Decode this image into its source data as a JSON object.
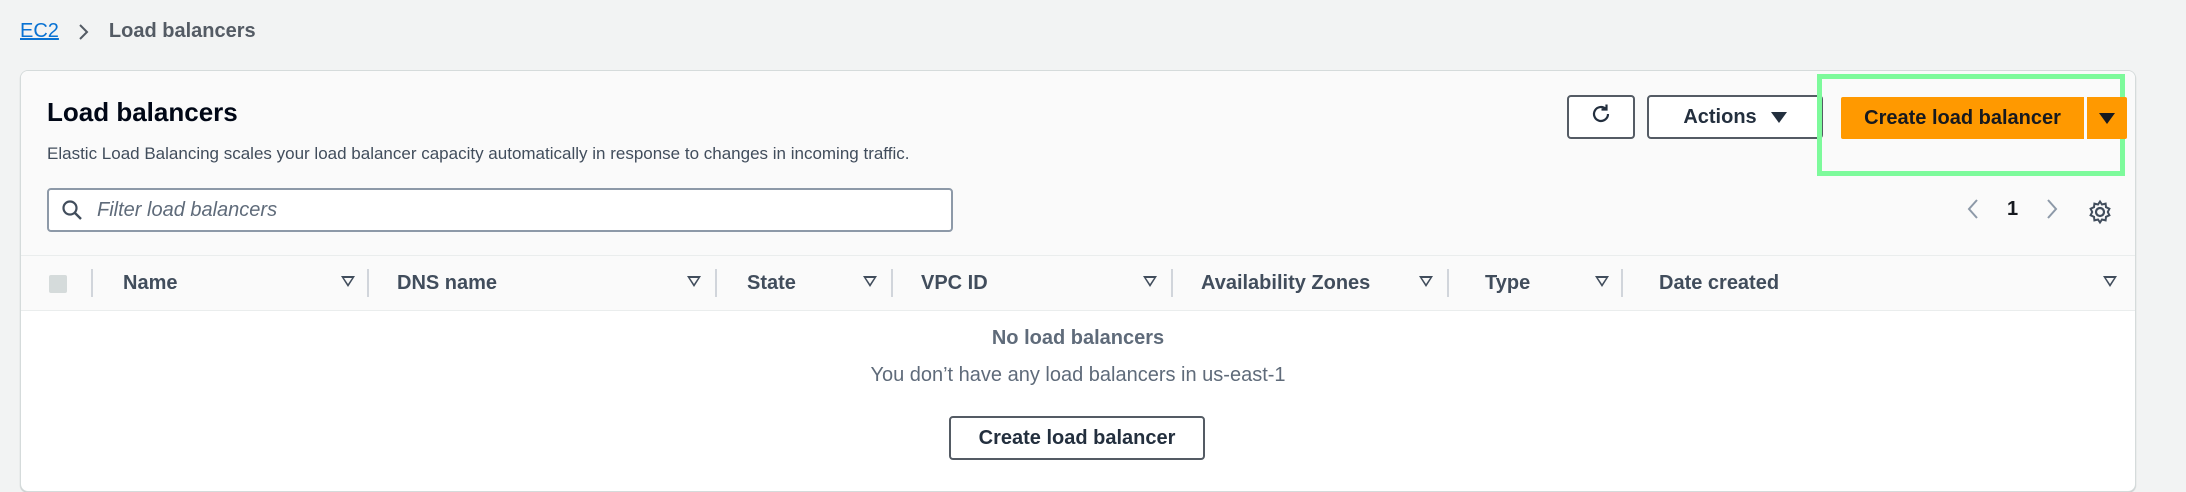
{
  "breadcrumb": {
    "root": "EC2",
    "current": "Load balancers"
  },
  "panel": {
    "title": "Load balancers",
    "description": "Elastic Load Balancing scales your load balancer capacity automatically in response to changes in incoming traffic."
  },
  "toolbar": {
    "actions_label": "Actions",
    "create_label": "Create load balancer"
  },
  "search": {
    "placeholder": "Filter load balancers",
    "value": ""
  },
  "pagination": {
    "current_page": "1"
  },
  "table": {
    "columns": [
      "Name",
      "DNS name",
      "State",
      "VPC ID",
      "Availability Zones",
      "Type",
      "Date created"
    ]
  },
  "empty_state": {
    "title": "No load balancers",
    "message": "You don’t have any load balancers in us-east-1",
    "button_label": "Create load balancer"
  },
  "colors": {
    "primary": "#ff9900",
    "link": "#0972d3",
    "highlight": "#7dfa9b"
  }
}
